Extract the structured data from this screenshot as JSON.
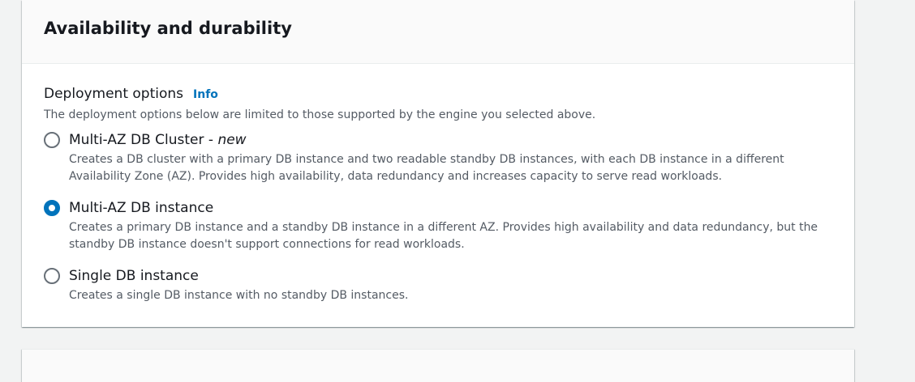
{
  "panel": {
    "title": "Availability and durability",
    "field_label": "Deployment options",
    "info_link": "Info",
    "field_description": "The deployment options below are limited to those supported by the engine you selected above."
  },
  "options": [
    {
      "label": "Multi-AZ DB Cluster - ",
      "label_suffix": "new",
      "description": "Creates a DB cluster with a primary DB instance and two readable standby DB instances, with each DB instance in a different Availability Zone (AZ). Provides high availability, data redundancy and increases capacity to serve read workloads.",
      "selected": false
    },
    {
      "label": "Multi-AZ DB instance",
      "description": "Creates a primary DB instance and a standby DB instance in a different AZ. Provides high availability and data redundancy, but the standby DB instance doesn't support connections for read workloads.",
      "selected": true
    },
    {
      "label": "Single DB instance",
      "description": "Creates a single DB instance with no standby DB instances.",
      "selected": false
    }
  ],
  "colors": {
    "accent": "#0073bb",
    "radio_unselected": "#687078",
    "description_text": "#545b64"
  }
}
